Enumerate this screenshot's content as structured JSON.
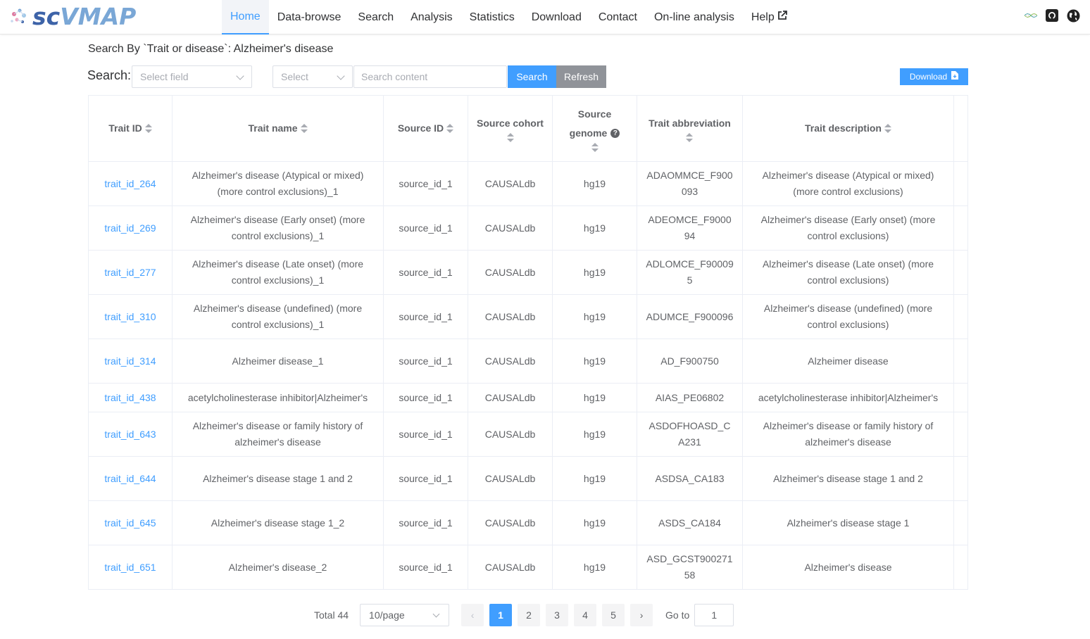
{
  "app": {
    "logo_sc": "sc",
    "logo_vmap": "VMAP"
  },
  "nav": {
    "items": [
      {
        "label": "Home",
        "active": true
      },
      {
        "label": "Data-browse"
      },
      {
        "label": "Search"
      },
      {
        "label": "Analysis"
      },
      {
        "label": "Statistics"
      },
      {
        "label": "Download"
      },
      {
        "label": "Contact"
      },
      {
        "label": "On-line analysis"
      },
      {
        "label": "Help"
      }
    ],
    "right_icons": [
      "dna-icon",
      "github-icon",
      "globe-icon"
    ]
  },
  "search": {
    "title": "Search By `Trait or disease`: Alzheimer's disease",
    "label": "Search:",
    "field_placeholder": "Select field",
    "select_placeholder": "Select",
    "content_placeholder": "Search content",
    "search_button": "Search",
    "refresh_button": "Refresh",
    "download_button": "Download"
  },
  "table": {
    "headers": {
      "trait_id": "Trait ID",
      "trait_name": "Trait name",
      "source_id": "Source ID",
      "source_cohort": "Source cohort",
      "source_genome_1": "Source",
      "source_genome_2": "genome",
      "trait_abbreviation": "Trait abbreviation",
      "trait_description": "Trait description"
    },
    "rows": [
      {
        "trait_id": "trait_id_264",
        "trait_name": "Alzheimer's disease (Atypical or mixed) (more control exclusions)_1",
        "source_id": "source_id_1",
        "source_cohort": "CAUSALdb",
        "source_genome": "hg19",
        "trait_abbreviation": "ADAOMMCE_F900093",
        "trait_description": "Alzheimer's disease (Atypical or mixed) (more control exclusions)"
      },
      {
        "trait_id": "trait_id_269",
        "trait_name": "Alzheimer's disease (Early onset) (more control exclusions)_1",
        "source_id": "source_id_1",
        "source_cohort": "CAUSALdb",
        "source_genome": "hg19",
        "trait_abbreviation": "ADEOMCE_F900094",
        "trait_description": "Alzheimer's disease (Early onset) (more control exclusions)"
      },
      {
        "trait_id": "trait_id_277",
        "trait_name": "Alzheimer's disease (Late onset) (more control exclusions)_1",
        "source_id": "source_id_1",
        "source_cohort": "CAUSALdb",
        "source_genome": "hg19",
        "trait_abbreviation": "ADLOMCE_F900095",
        "trait_description": "Alzheimer's disease (Late onset) (more control exclusions)"
      },
      {
        "trait_id": "trait_id_310",
        "trait_name": "Alzheimer's disease (undefined) (more control exclusions)_1",
        "source_id": "source_id_1",
        "source_cohort": "CAUSALdb",
        "source_genome": "hg19",
        "trait_abbreviation": "ADUMCE_F900096",
        "trait_description": "Alzheimer's disease (undefined) (more control exclusions)"
      },
      {
        "trait_id": "trait_id_314",
        "trait_name": "Alzheimer disease_1",
        "source_id": "source_id_1",
        "source_cohort": "CAUSALdb",
        "source_genome": "hg19",
        "trait_abbreviation": "AD_F900750",
        "trait_description": "Alzheimer disease"
      },
      {
        "trait_id": "trait_id_438",
        "trait_name": "acetylcholinesterase inhibitor|Alzheimer's",
        "source_id": "source_id_1",
        "source_cohort": "CAUSALdb",
        "source_genome": "hg19",
        "trait_abbreviation": "AIAS_PE06802",
        "trait_description": "acetylcholinesterase inhibitor|Alzheimer's"
      },
      {
        "trait_id": "trait_id_643",
        "trait_name": "Alzheimer's disease or family history of alzheimer's disease",
        "source_id": "source_id_1",
        "source_cohort": "CAUSALdb",
        "source_genome": "hg19",
        "trait_abbreviation": "ASDOFHOASD_CA231",
        "trait_description": "Alzheimer's disease or family history of alzheimer's disease"
      },
      {
        "trait_id": "trait_id_644",
        "trait_name": "Alzheimer's disease stage 1 and 2",
        "source_id": "source_id_1",
        "source_cohort": "CAUSALdb",
        "source_genome": "hg19",
        "trait_abbreviation": "ASDSA_CA183",
        "trait_description": "Alzheimer's disease stage 1 and 2"
      },
      {
        "trait_id": "trait_id_645",
        "trait_name": "Alzheimer's disease stage 1_2",
        "source_id": "source_id_1",
        "source_cohort": "CAUSALdb",
        "source_genome": "hg19",
        "trait_abbreviation": "ASDS_CA184",
        "trait_description": "Alzheimer's disease stage 1"
      },
      {
        "trait_id": "trait_id_651",
        "trait_name": "Alzheimer's disease_2",
        "source_id": "source_id_1",
        "source_cohort": "CAUSALdb",
        "source_genome": "hg19",
        "trait_abbreviation": "ASD_GCST90027158",
        "trait_description": "Alzheimer's disease"
      }
    ]
  },
  "pagination": {
    "total": "Total 44",
    "page_size": "10/page",
    "pages": [
      "1",
      "2",
      "3",
      "4",
      "5"
    ],
    "current_page": "1",
    "goto_label": "Go to",
    "goto_value": "1",
    "prev": "‹",
    "next": "›"
  },
  "colors": {
    "primary": "#409eff",
    "refresh": "#909399",
    "logo_dark": "#3d63a8",
    "logo_light": "#7aa7d6"
  }
}
